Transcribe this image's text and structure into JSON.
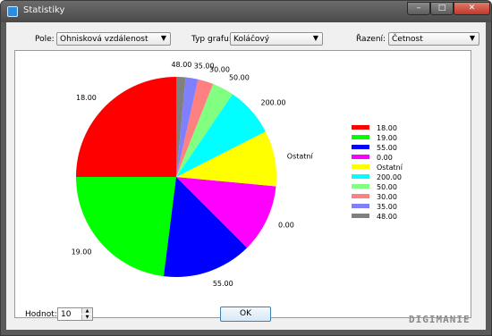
{
  "window": {
    "title": "Statistiky",
    "buttons": {
      "minimize": "–",
      "maximize": "□",
      "close": "✕"
    },
    "icons": [
      "app-icon"
    ]
  },
  "controls": {
    "pole": {
      "label": "Pole:",
      "value": "Ohnisková vzdálenost"
    },
    "typ": {
      "label": "Typ grafu:",
      "value": "Koláčový"
    },
    "razeni": {
      "label": "Řazení:",
      "value": "Četnost"
    }
  },
  "bottom": {
    "hodnota_label": "Hodnot:",
    "hodnota_value": "10",
    "ok_label": "OK",
    "watermark": "DIGIMANIE"
  },
  "chart_data": {
    "type": "pie",
    "title": "",
    "start": "12 o'clock",
    "direction": "counterclockwise",
    "slices": [
      {
        "label": "18.00",
        "value": 25.0,
        "color": "#ff0000"
      },
      {
        "label": "19.00",
        "value": 23.0,
        "color": "#00ff00"
      },
      {
        "label": "55.00",
        "value": 14.5,
        "color": "#0000ff"
      },
      {
        "label": "0.00",
        "value": 11.0,
        "color": "#ff00ff"
      },
      {
        "label": "Ostatní",
        "value": 9.0,
        "color": "#ffff00"
      },
      {
        "label": "200.00",
        "value": 8.0,
        "color": "#00ffff"
      },
      {
        "label": "50.00",
        "value": 3.5,
        "color": "#80ff80"
      },
      {
        "label": "30.00",
        "value": 2.5,
        "color": "#ff8080"
      },
      {
        "label": "35.00",
        "value": 2.0,
        "color": "#8080ff"
      },
      {
        "label": "48.00",
        "value": 1.5,
        "color": "#808080"
      }
    ],
    "legend": "right"
  }
}
